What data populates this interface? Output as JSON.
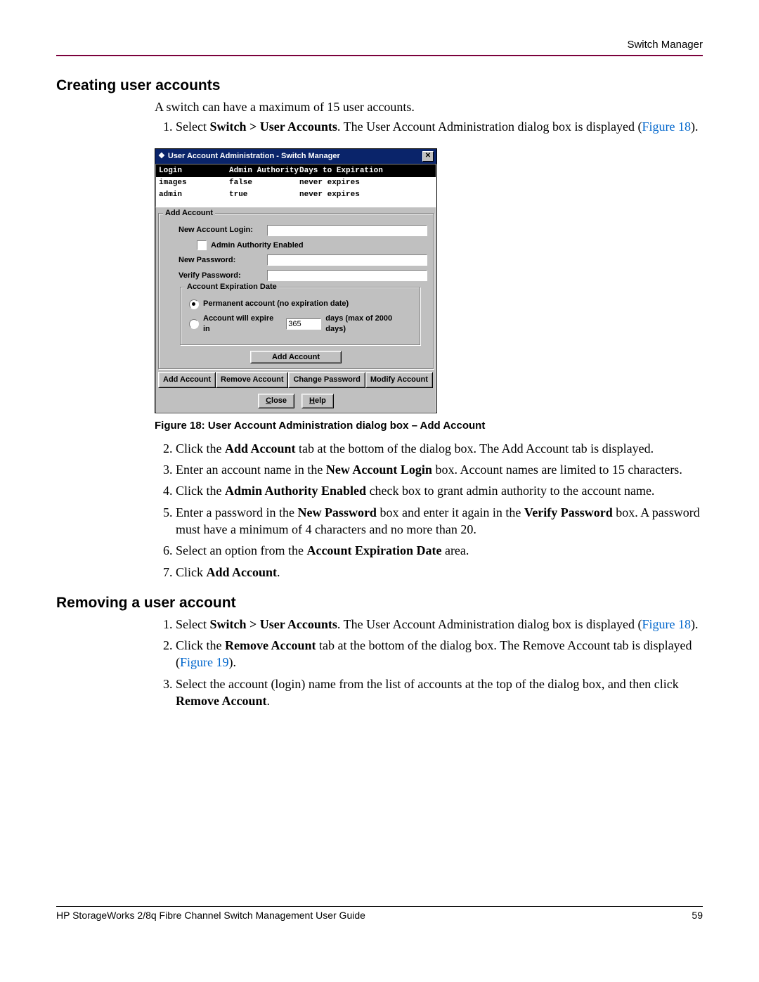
{
  "header": {
    "chapter": "Switch Manager"
  },
  "section1": {
    "title": "Creating user accounts",
    "intro": "A switch can have a maximum of 15 user accounts.",
    "steps": {
      "s1a": "Select ",
      "s1b": "Switch > User Accounts",
      "s1c": ". The User Account Administration dialog box is displayed (",
      "s1d": "Figure 18",
      "s1e": ").",
      "s2a": "Click the ",
      "s2b": "Add Account",
      "s2c": " tab at the bottom of the dialog box. The Add Account tab is displayed.",
      "s3a": "Enter an account name in the ",
      "s3b": "New Account Login",
      "s3c": " box. Account names are limited to 15 characters.",
      "s4a": "Click the ",
      "s4b": "Admin Authority Enabled",
      "s4c": " check box to grant admin authority to the account name.",
      "s5a": "Enter a password in the ",
      "s5b": "New Password",
      "s5c": " box and enter it again in the ",
      "s5d": "Verify Password",
      "s5e": " box. A password must have a minimum of 4 characters and no more than 20.",
      "s6a": "Select an option from the ",
      "s6b": "Account Expiration Date",
      "s6c": " area.",
      "s7a": "Click ",
      "s7b": "Add Account",
      "s7c": "."
    }
  },
  "figure": {
    "caption": "Figure 18:   User Account Administration dialog box – Add Account",
    "dialog": {
      "title": "User Account Administration - Switch Manager",
      "cols": {
        "c1": "Login",
        "c2": "Admin Authority",
        "c3": "Days to Expiration"
      },
      "rows": [
        {
          "c1": "images",
          "c2": "false",
          "c3": "never expires"
        },
        {
          "c1": "admin",
          "c2": "true",
          "c3": "never expires"
        }
      ],
      "group_title": "Add Account",
      "lbl_newlogin": "New Account Login:",
      "chk_admin": "Admin Authority Enabled",
      "lbl_newpass": "New Password:",
      "lbl_verify": "Verify Password:",
      "exp_group": "Account Expiration Date",
      "radio_perm": "Permanent account (no expiration date)",
      "radio_exp_a": "Account will expire in",
      "radio_exp_b": "days (max of 2000 days)",
      "exp_value": "365",
      "btn_add": "Add Account",
      "tabs": [
        "Add Account",
        "Remove Account",
        "Change Password",
        "Modify Account"
      ],
      "btn_close": "Close",
      "btn_help": "Help"
    }
  },
  "section2": {
    "title": "Removing a user account",
    "steps": {
      "s1a": "Select ",
      "s1b": "Switch > User Accounts",
      "s1c": ". The User Account Administration dialog box is displayed (",
      "s1d": "Figure 18",
      "s1e": ").",
      "s2a": "Click the ",
      "s2b": "Remove Account",
      "s2c": " tab at the bottom of the dialog box. The Remove Account tab is displayed (",
      "s2d": "Figure 19",
      "s2e": ").",
      "s3a": "Select the account (login) name from the list of accounts at the top of the dialog box, and then click ",
      "s3b": "Remove Account",
      "s3c": "."
    }
  },
  "footer": {
    "left": "HP StorageWorks 2/8q Fibre Channel Switch Management User Guide",
    "right": "59"
  }
}
